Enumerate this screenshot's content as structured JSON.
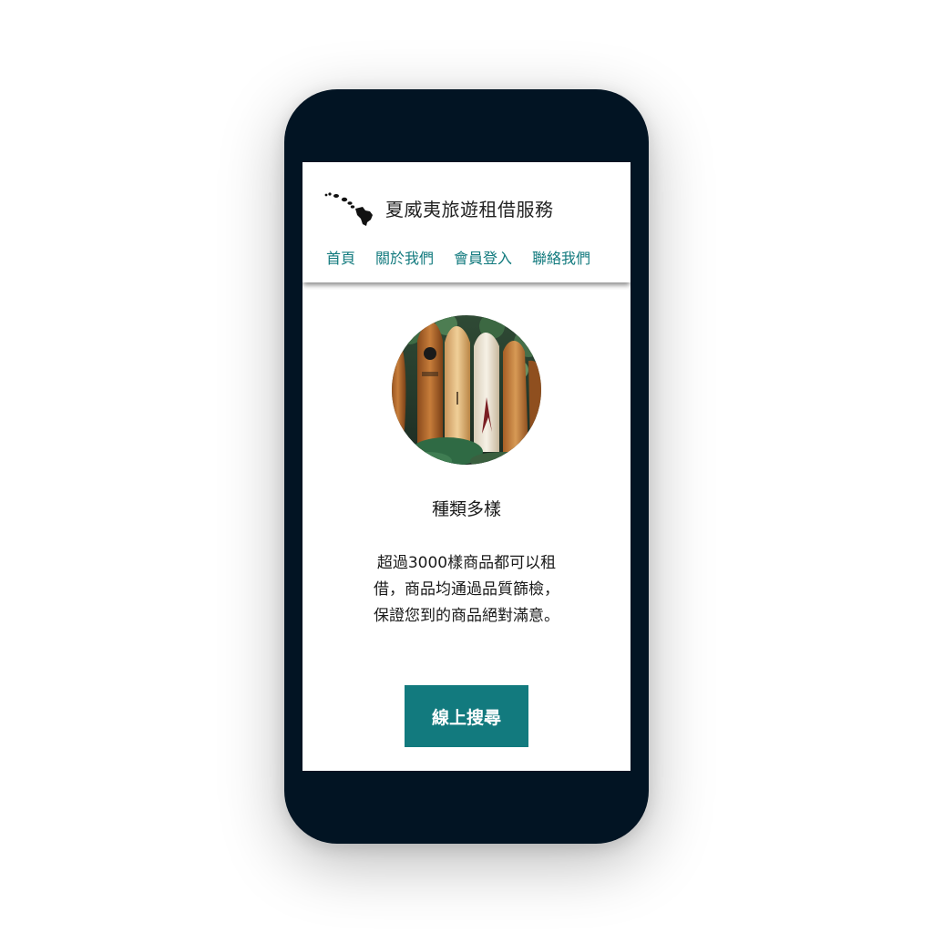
{
  "site": {
    "title": "夏威夷旅遊租借服務",
    "logo_icon": "hawaii-islands-icon"
  },
  "nav": {
    "items": [
      {
        "label": "首頁"
      },
      {
        "label": "關於我們"
      },
      {
        "label": "會員登入"
      },
      {
        "label": "聯絡我們"
      }
    ]
  },
  "feature": {
    "image_icon": "surfboards-photo",
    "title": "種類多樣",
    "description": "超過3000樣商品都可以租借，商品均通過品質篩檢，保證您到的商品絕對滿意。"
  },
  "cta": {
    "label": "線上搜尋"
  },
  "colors": {
    "accent": "#127a7e",
    "phone_frame": "#021423",
    "text": "#1a1a1a"
  }
}
